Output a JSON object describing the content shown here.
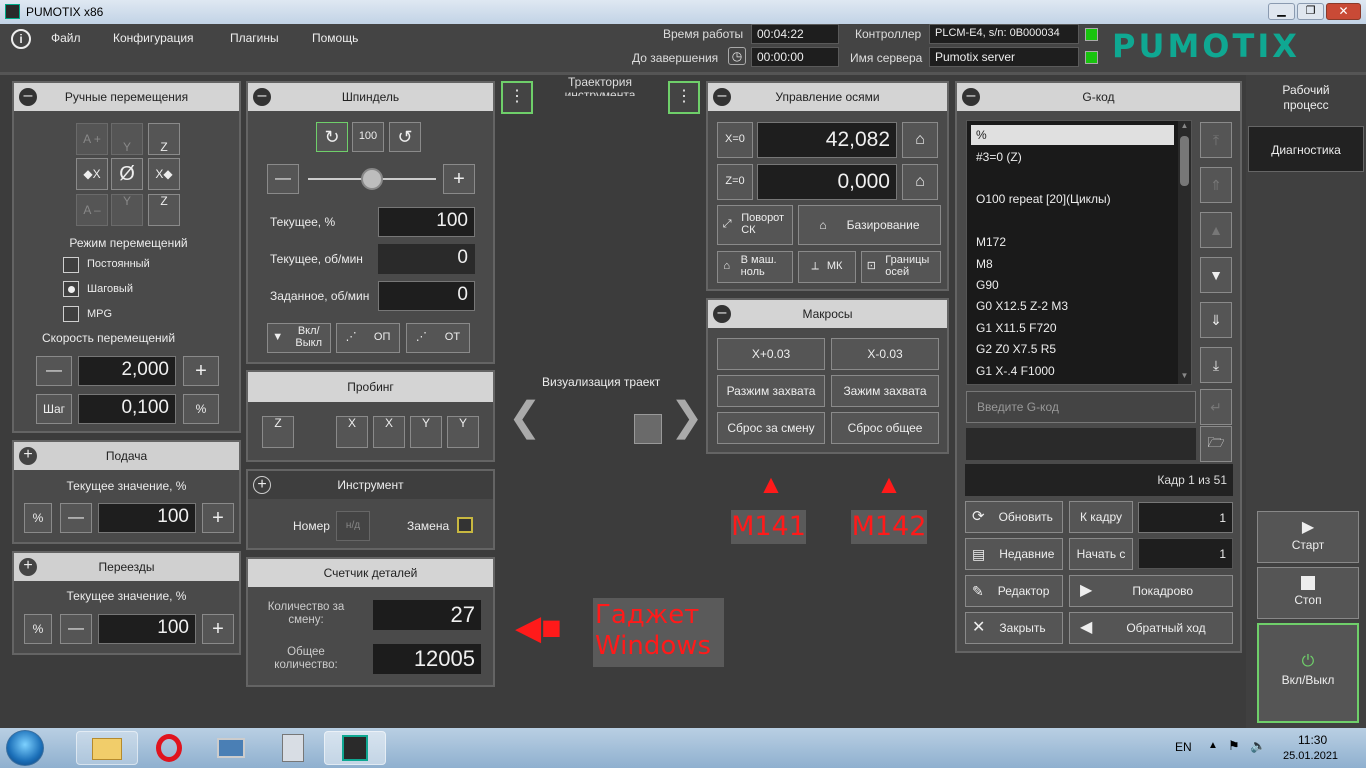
{
  "window": {
    "title": "PUMOTIX x86",
    "logo": "PUMOTIX"
  },
  "menu": [
    "Файл",
    "Конфигурация",
    "Плагины",
    "Помощь"
  ],
  "status": {
    "work_time_label": "Время работы",
    "work_time": "00:04:22",
    "remaining_label": "До завершения",
    "remaining": "00:00:00",
    "controller_label": "Контроллер",
    "controller": "PLCM-E4, s/n: 0B000034",
    "server_label": "Имя сервера",
    "server": "Pumotix server"
  },
  "manual": {
    "title": "Ручные перемещения",
    "jog": [
      "A +",
      "Y",
      "Z",
      "X",
      "Ø",
      "X",
      "A –",
      "Y",
      "Z"
    ],
    "mode_title": "Режим перемещений",
    "modes": [
      "Постоянный",
      "Шаговый",
      "MPG"
    ],
    "speed_title": "Скорость перемещений",
    "speed": "2,000",
    "step_label": "Шаг",
    "step": "0,100",
    "pct": "%",
    "minus": "—",
    "plus": "+"
  },
  "feed": {
    "title": "Подача",
    "caption": "Текущее значение, %",
    "value": "100"
  },
  "rapid": {
    "title": "Переезды",
    "caption": "Текущее значение, %",
    "value": "100"
  },
  "spindle": {
    "title": "Шпиндель",
    "hundred": "100",
    "current_pct_label": "Текущее, %",
    "current_pct": "100",
    "current_rpm_label": "Текущее, об/мин",
    "current_rpm": "0",
    "set_rpm_label": "Заданное, об/мин",
    "set_rpm": "0",
    "onoff": "Вкл/ Выкл",
    "op": "ОП",
    "ot": "ОТ"
  },
  "probing": {
    "title": "Пробинг",
    "z": "Z",
    "x1": "X",
    "x2": "X",
    "y1": "Y",
    "y2": "Y"
  },
  "tool": {
    "title": "Инструмент",
    "number_label": "Номер",
    "number_placeholder": "н/д",
    "change_label": "Замена"
  },
  "counter": {
    "title": "Счетчик деталей",
    "shift_label": "Количество за смену:",
    "shift": "27",
    "total_label": "Общее количество:",
    "total": "12005"
  },
  "view": {
    "trajectory": "Траектория инструмента",
    "visual": "Визуализация траект"
  },
  "axes": {
    "title": "Управление осями",
    "x_btn": "X=0",
    "x_val": "42,082",
    "z_btn": "Z=0",
    "z_val": "0,000",
    "rotate": "Поворот СК",
    "homing": "Базирование",
    "machine_zero": "В маш. ноль",
    "mk": "МК",
    "limits": "Границы осей"
  },
  "macros": {
    "title": "Макросы",
    "buttons": [
      "X+0.03",
      "X-0.03",
      "Разжим захвата",
      "Зажим захвата",
      "Сброс за смену",
      "Сброс общее"
    ]
  },
  "annotations": {
    "m141": "M141",
    "m142": "M142",
    "gadget": "Гаджет Windows"
  },
  "gcode": {
    "title": "G-код",
    "lines": [
      "%",
      "#3=0 (Z)",
      "",
      "O100 repeat [20](Циклы)",
      "",
      "M172",
      "M8",
      "G90",
      "G0 X12.5 Z-2 M3",
      "G1 X11.5 F720",
      "G2 Z0 X7.5 R5",
      "G1 X-.4 F1000"
    ],
    "input_placeholder": "Введите G-код",
    "frame_info": "Кадр 1 из 51",
    "refresh": "Обновить",
    "to_frame": "К кадру",
    "to_frame_val": "1",
    "recent": "Недавние",
    "start_from": "Начать с",
    "start_from_val": "1",
    "editor": "Редактор",
    "step_mode": "Покадрово",
    "close": "Закрыть",
    "reverse": "Обратный ход"
  },
  "right": {
    "workflow": "Рабочий процесс",
    "diagnostics": "Диагностика",
    "start": "Старт",
    "stop": "Стоп",
    "power": "Вкл/Выкл"
  },
  "taskbar": {
    "lang": "EN",
    "time": "11:30",
    "date": "25.01.2021"
  }
}
